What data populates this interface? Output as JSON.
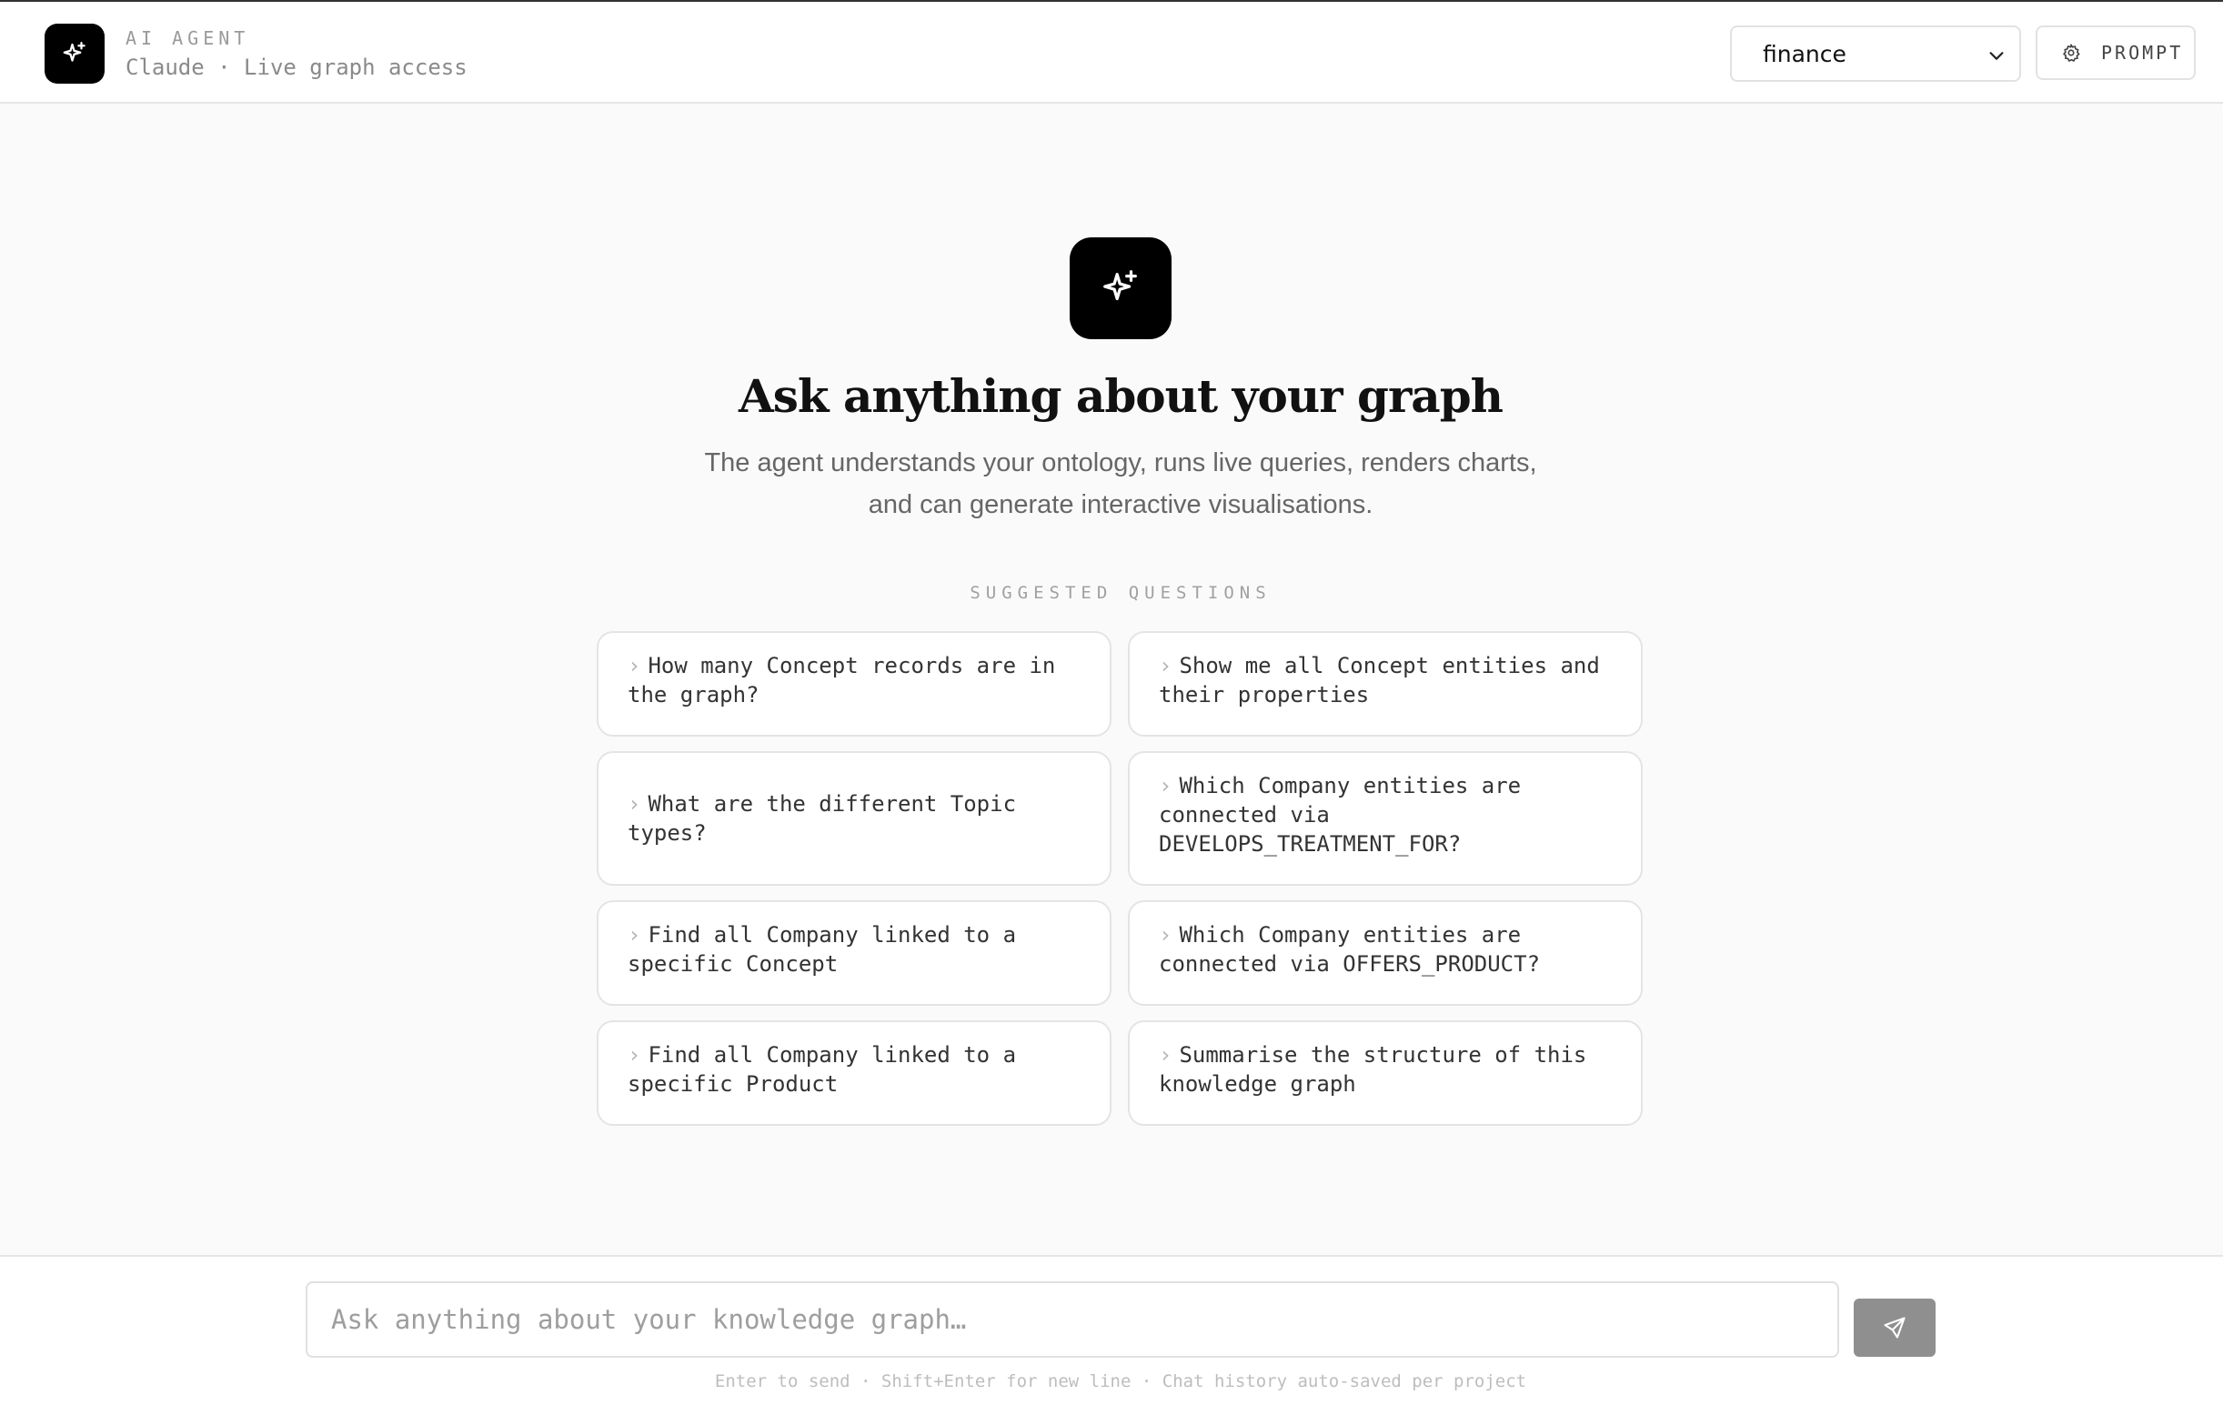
{
  "header": {
    "kicker": "AI AGENT",
    "subtitle": "Claude · Live graph access",
    "project_selected": "finance",
    "prompt_label": "PROMPT"
  },
  "hero": {
    "title": "Ask anything about your graph",
    "subtitle": "The agent understands your ontology, runs live queries, renders charts, and can generate interactive visualisations."
  },
  "suggestions": {
    "label": "SUGGESTED QUESTIONS",
    "items": [
      "How many Concept records are in the graph?",
      "Show me all Concept entities and their properties",
      "What are the different Topic types?",
      "Which Company entities are connected via DEVELOPS_TREATMENT_FOR?",
      "Find all Company linked to a specific Concept",
      "Which Company entities are connected via OFFERS_PRODUCT?",
      "Find all Company linked to a specific Product",
      "Summarise the structure of this knowledge graph"
    ]
  },
  "composer": {
    "placeholder": "Ask anything about your knowledge graph…",
    "hint": "Enter to send · Shift+Enter for new line · Chat history auto-saved per project"
  },
  "icons": {
    "logo": "sparkle-icon",
    "hero": "sparkle-icon",
    "prompt": "gear-icon",
    "select": "chevron-down-icon",
    "send": "send-icon"
  },
  "colors": {
    "accent": "#000000",
    "background": "#fafafa",
    "send_button": "#8f8f8f"
  }
}
